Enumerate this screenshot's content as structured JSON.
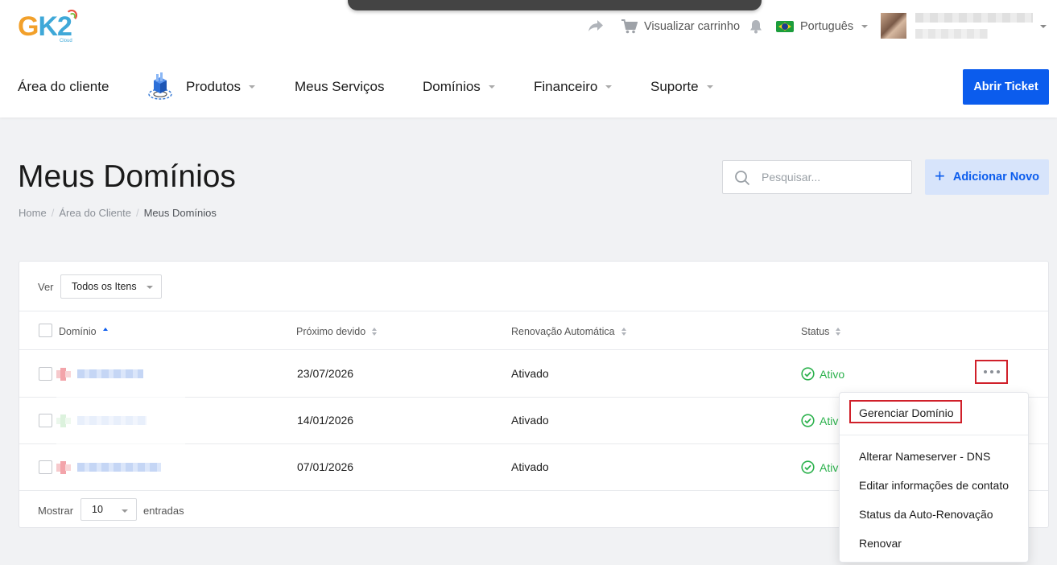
{
  "header": {
    "logo_text": "GK2",
    "logo_sub": "Cloud",
    "cart_label": "Visualizar carrinho",
    "language": "Português",
    "nav": [
      {
        "label": "Área do cliente"
      },
      {
        "label": "Produtos"
      },
      {
        "label": "Meus Serviços"
      },
      {
        "label": "Domínios"
      },
      {
        "label": "Financeiro"
      },
      {
        "label": "Suporte"
      }
    ],
    "open_ticket_label": "Abrir Ticket"
  },
  "page": {
    "title": "Meus Domínios",
    "breadcrumb": [
      "Home",
      "Área do Cliente",
      "Meus Domínios"
    ],
    "search_placeholder": "Pesquisar...",
    "add_new_label": "Adicionar Novo"
  },
  "table": {
    "filter_label": "Ver",
    "filter_value": "Todos os Itens",
    "columns": [
      "Domínio",
      "Próximo devido",
      "Renovação Automática",
      "Status"
    ],
    "rows": [
      {
        "due": "23/07/2026",
        "auto_renew": "Ativado",
        "status": "Ativo"
      },
      {
        "due": "14/01/2026",
        "auto_renew": "Ativado",
        "status": "Ativo"
      },
      {
        "due": "07/01/2026",
        "auto_renew": "Ativado",
        "status": "Ativo"
      }
    ],
    "show_label": "Mostrar",
    "page_length": "10",
    "entries_label": "entradas"
  },
  "actions_menu": {
    "items": [
      "Gerenciar Domínio",
      "Alterar Nameserver - DNS",
      "Editar informações de contato",
      "Status da Auto-Renovação",
      "Renovar"
    ]
  },
  "colors": {
    "primary": "#0b5ced",
    "status_active": "#2bb14c",
    "highlight_border": "#d0202a"
  }
}
